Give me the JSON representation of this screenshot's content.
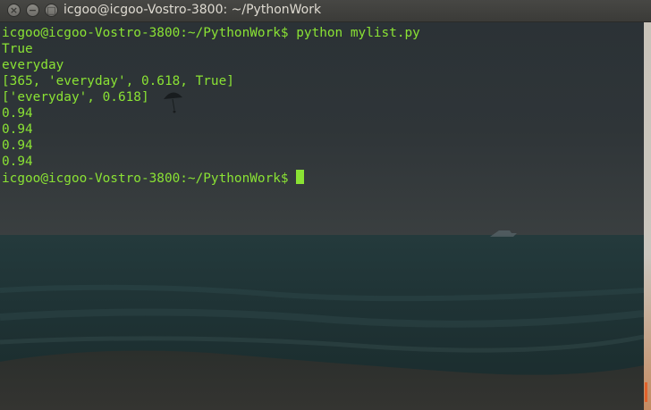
{
  "window": {
    "title": "icgoo@icgoo-Vostro-3800: ~/PythonWork",
    "buttons": {
      "close_glyph": "×",
      "minimize_glyph": "−",
      "maximize_glyph": "□"
    }
  },
  "terminal": {
    "text_color": "#8ae234",
    "lines": [
      "icgoo@icgoo-Vostro-3800:~/PythonWork$ python mylist.py",
      "True",
      "everyday",
      "[365, 'everyday', 0.618, True]",
      "['everyday', 0.618]",
      "0.94",
      "0.94",
      "0.94",
      "0.94"
    ],
    "prompt": "icgoo@icgoo-Vostro-3800:~/PythonWork$ "
  },
  "background": {
    "description_icon": "sea-horizon-wallpaper"
  }
}
